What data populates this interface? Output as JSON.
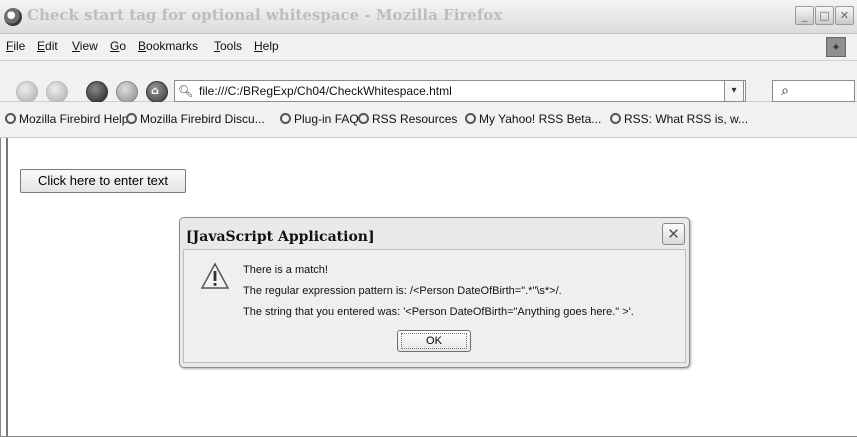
{
  "window": {
    "title": "Check start tag for optional whitespace - Mozilla Firefox",
    "minimize_glyph": "_",
    "maximize_glyph": "□",
    "close_glyph": "✕"
  },
  "menu": {
    "items": [
      {
        "label": "File",
        "key": "F",
        "rest": "ile"
      },
      {
        "label": "Edit",
        "key": "E",
        "rest": "dit"
      },
      {
        "label": "View",
        "key": "V",
        "rest": "iew"
      },
      {
        "label": "Go",
        "key": "G",
        "rest": "o"
      },
      {
        "label": "Bookmarks",
        "key": "B",
        "rest": "ookmarks"
      },
      {
        "label": "Tools",
        "key": "T",
        "rest": "ools"
      },
      {
        "label": "Help",
        "key": "H",
        "rest": "elp"
      }
    ]
  },
  "navigation": {
    "url": "file:///C:/BRegExp/Ch04/CheckWhitespace.html",
    "dropdown_glyph": "▾",
    "search_icon": "magnifier-icon"
  },
  "bookmarks": [
    "Mozilla Firebird Help",
    "Mozilla Firebird Discu...",
    "Plug-in FAQ",
    "RSS Resources",
    "My Yahoo! RSS Beta...",
    "RSS: What RSS is, w..."
  ],
  "page": {
    "button_label": "Click here to enter text"
  },
  "dialog": {
    "title": "[JavaScript Application]",
    "close_glyph": "✕",
    "line1": "There is a match!",
    "line2": "The regular expression pattern is: /<Person DateOfBirth=\".*\"\\s*>/.",
    "line3": "The string that you entered was: '<Person DateOfBirth=\"Anything goes here.\" >'.",
    "ok_label": "OK"
  }
}
